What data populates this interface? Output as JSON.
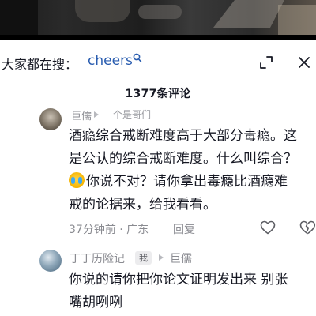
{
  "search": {
    "prefix": "大家都在搜：",
    "term": "cheers"
  },
  "comments_header": {
    "count_label": "1377条评论"
  },
  "comments": [
    {
      "author": "巨儒",
      "reply_to": "个是哥们",
      "lines": [
        "酒瘾综合戒断难度高于大部分毒瘾。这",
        "是公认的综合戒断难度。什么叫综合？",
        "你说不对？请你拿出毒瘾比酒瘾难",
        "戒的论据来，给我看看。"
      ],
      "time_location": "37分钟前 · 广东",
      "reply_label": "回复"
    },
    {
      "author": "丁丁历险记",
      "author_tag": "我",
      "reply_to": "巨儒",
      "lines": [
        "你说的请你把你论文证明发出来 别张",
        "嘴胡咧咧"
      ]
    }
  ],
  "icons": {
    "search": "search-icon",
    "expand": "expand-icon",
    "close": "close-icon",
    "like": "heart-icon",
    "dislike": "broken-heart-icon",
    "emoji": "crying-face-emoji"
  },
  "colors": {
    "link": "#2a5db0",
    "meta": "#8a8b91",
    "text": "#161823"
  }
}
